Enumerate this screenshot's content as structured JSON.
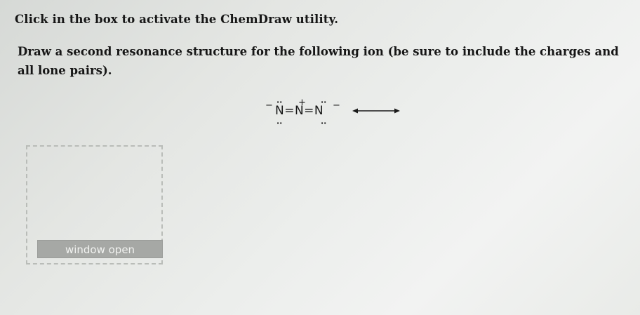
{
  "instruction": "Click in the box to activate the ChemDraw utility.",
  "question": "Draw a second resonance structure for the following ion (be sure to include the charges and all lone pairs).",
  "structure": {
    "formula": "N=N=N",
    "left_charge": "−",
    "center_charge": "+",
    "right_charge": "−",
    "lone_pair": "··"
  },
  "drawing_area": {
    "button_label": "window open"
  },
  "icons": {
    "resonance_arrow": "double-headed-arrow-icon"
  }
}
